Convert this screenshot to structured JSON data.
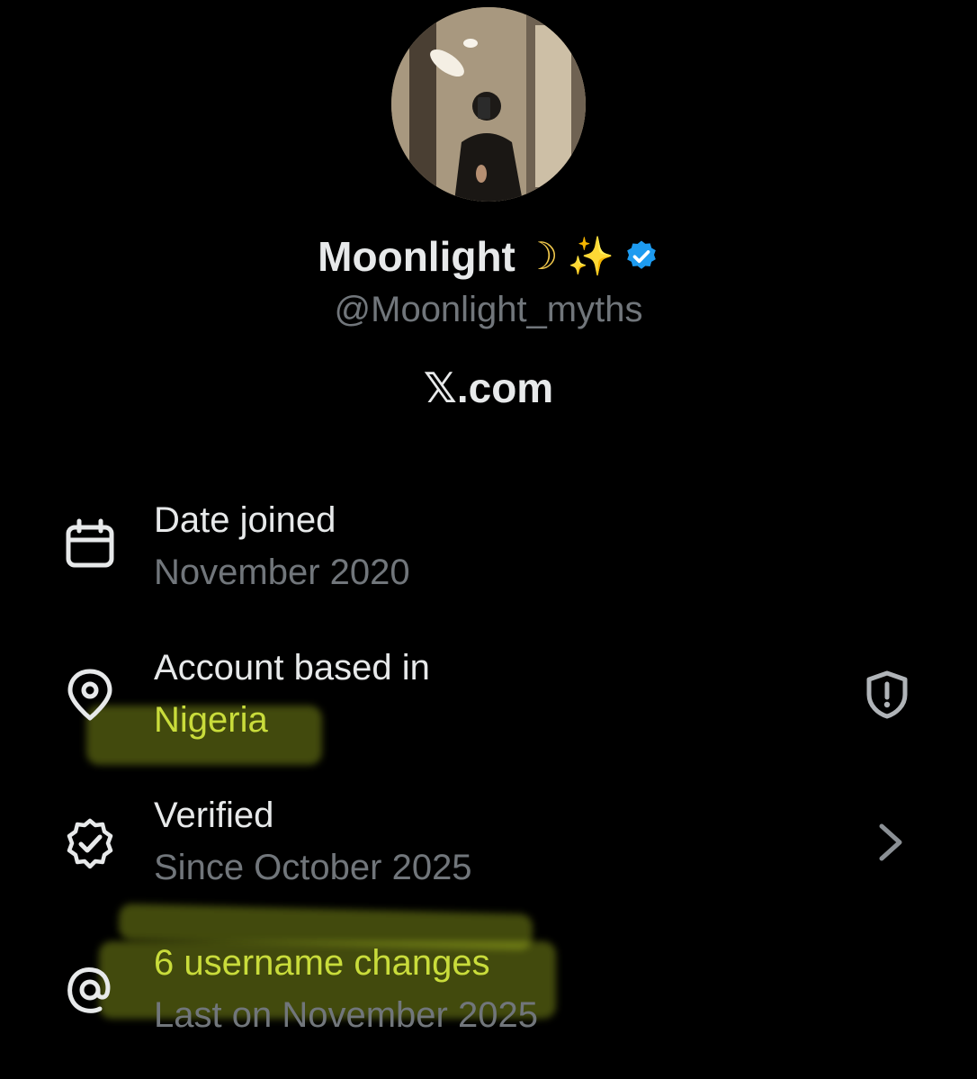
{
  "profile": {
    "display_name": "Moonlight",
    "emoji_moon": "☽",
    "emoji_sparkles": "✨",
    "handle": "@Moonlight_myths",
    "site": "𝕏.com",
    "verified_color": "#1d9bf0"
  },
  "details": {
    "date_joined": {
      "title": "Date joined",
      "value": "November 2020",
      "icon": "calendar-icon"
    },
    "account_based": {
      "title": "Account based in",
      "value": "Nigeria",
      "icon": "location-pin-icon",
      "right_icon": "shield-alert-icon"
    },
    "verified": {
      "title": "Verified",
      "value": "Since October 2025",
      "icon": "verified-seal-icon",
      "right_icon": "chevron-right-icon"
    },
    "username_changes": {
      "title": "6 username changes",
      "value": "Last on November 2025",
      "icon": "at-sign-icon"
    }
  },
  "colors": {
    "background": "#000000",
    "primary_text": "#e7e9ea",
    "secondary_text": "#71767b",
    "highlighter": "#cce628"
  }
}
